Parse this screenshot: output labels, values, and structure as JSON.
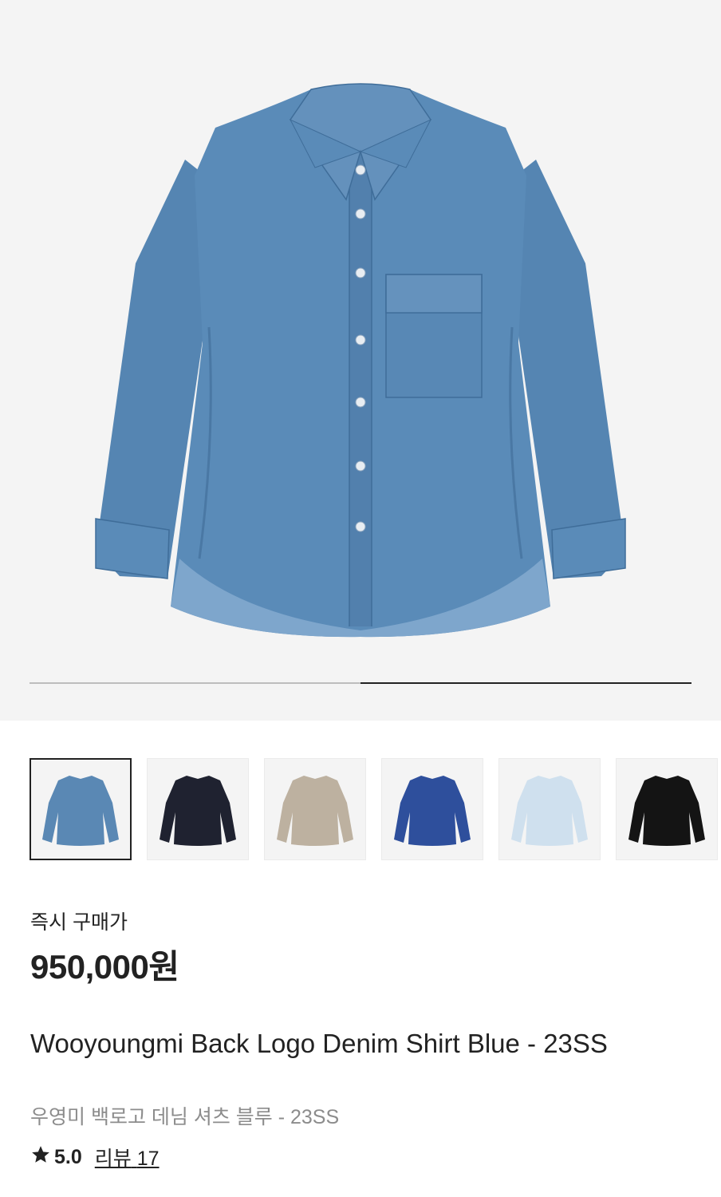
{
  "product": {
    "image": "denim-shirt-front",
    "gallery_progress": 0.5,
    "price_label": "즉시 구매가",
    "price": "950,000원",
    "title": "Wooyoungmi Back Logo Denim Shirt Blue - 23SS",
    "subtitle": "우영미 백로고 데님 셔츠 블루 - 23SS",
    "rating": "5.0",
    "review_label": "리뷰",
    "review_count": "17"
  },
  "thumbnails": [
    {
      "name": "thumb-denim-blue-back",
      "color": "#5a88b4",
      "selected": true
    },
    {
      "name": "thumb-navy-shirt",
      "color": "#1f2230",
      "selected": false
    },
    {
      "name": "thumb-beige-shirt",
      "color": "#bdb1a0",
      "selected": false
    },
    {
      "name": "thumb-blue-printed-shirt",
      "color": "#2e4f9c",
      "selected": false
    },
    {
      "name": "thumb-light-blue-shirt",
      "color": "#cfe0ee",
      "selected": false
    },
    {
      "name": "thumb-black-shirt",
      "color": "#141414",
      "selected": false
    }
  ],
  "colors": {
    "denim": "#5a8bb8",
    "denim_dark": "#4a78a4",
    "hero_bg": "#f4f4f4",
    "star": "#222222"
  }
}
